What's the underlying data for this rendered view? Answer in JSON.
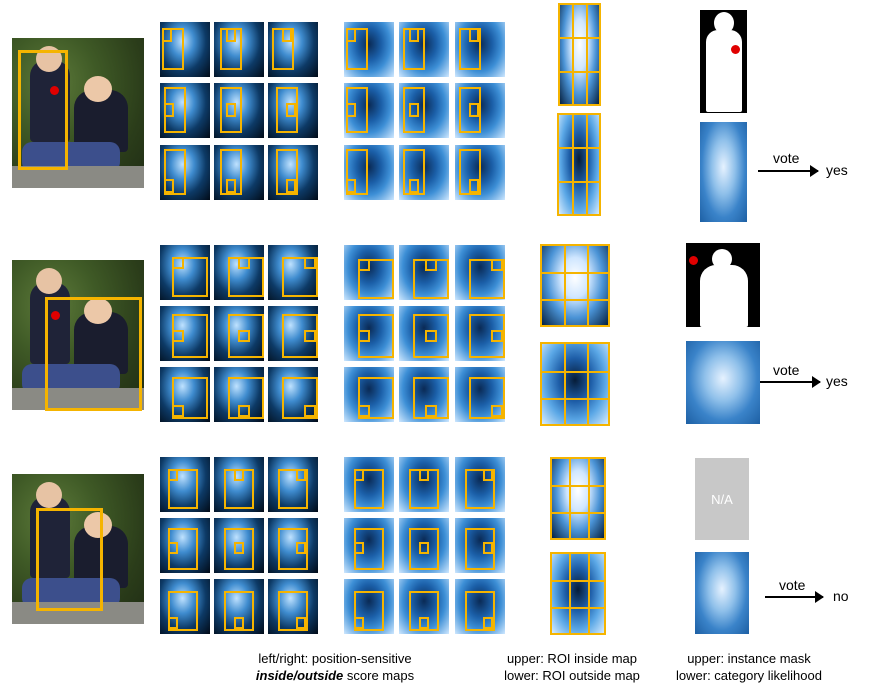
{
  "rows": [
    {
      "vote_label": "vote",
      "result": "yes",
      "mask_placeholder": ""
    },
    {
      "vote_label": "vote",
      "result": "yes",
      "mask_placeholder": ""
    },
    {
      "vote_label": "vote",
      "result": "no",
      "mask_placeholder": "N/A"
    }
  ],
  "captions": {
    "score_maps_line1": "left/right: position-sensitive",
    "score_maps_line2_em": "inside/outside",
    "score_maps_line2_rest": " score maps",
    "roi_maps_line1": "upper: ROI inside map",
    "roi_maps_line2": "lower: ROI outside map",
    "output_line1": "upper: instance mask",
    "output_line2": "lower: category likelihood"
  },
  "colors": {
    "roi_box": "#f5b400",
    "point": "#e00000",
    "na_box": "#c8c8c8"
  }
}
